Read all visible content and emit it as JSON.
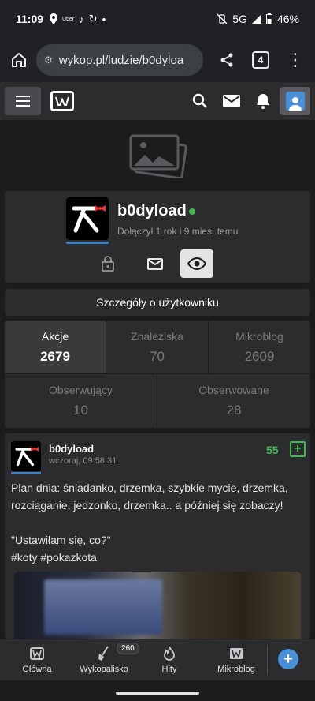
{
  "status": {
    "time": "11:09",
    "network": "5G",
    "battery": "46%",
    "notif_icons": [
      "location-pin-icon",
      "uber-icon",
      "tiktok-icon",
      "sync-icon",
      "dot-icon"
    ]
  },
  "browser": {
    "url": "wykop.pl/ludzie/b0dyloa",
    "tab_count": "4"
  },
  "profile": {
    "username": "b0dyload",
    "joined": "Dołączył 1 rok i 9 mies. temu",
    "details_label": "Szczegóły o użytkowniku"
  },
  "stats": [
    {
      "label": "Akcje",
      "value": "2679",
      "active": true
    },
    {
      "label": "Znaleziska",
      "value": "70",
      "active": false
    },
    {
      "label": "Mikroblog",
      "value": "2609",
      "active": false
    },
    {
      "label": "Obserwujący",
      "value": "10",
      "active": false
    },
    {
      "label": "Obserwowane",
      "value": "28",
      "active": false
    }
  ],
  "entry": {
    "author": "b0dyload",
    "date": "wczoraj, 09:58:31",
    "votes": "55",
    "plus": "+",
    "line1": "Plan dnia: śniadanko, drzemka, szybkie mycie, drzemka, rozciąganie, jedzonko, drzemka.. a później się zobaczy!",
    "line2": "\"Ustawiłam się, co?\"",
    "line3": "#koty #pokazkota"
  },
  "bottom_nav": {
    "items": [
      "Główna",
      "Wykopalisko",
      "Hity",
      "Mikroblog"
    ],
    "badge": "260",
    "fab": "+"
  },
  "colors": {
    "accent_green": "#3fb950",
    "accent_blue": "#4a90d9",
    "bg": "#1c1c1e",
    "card": "#2c2c2e"
  }
}
